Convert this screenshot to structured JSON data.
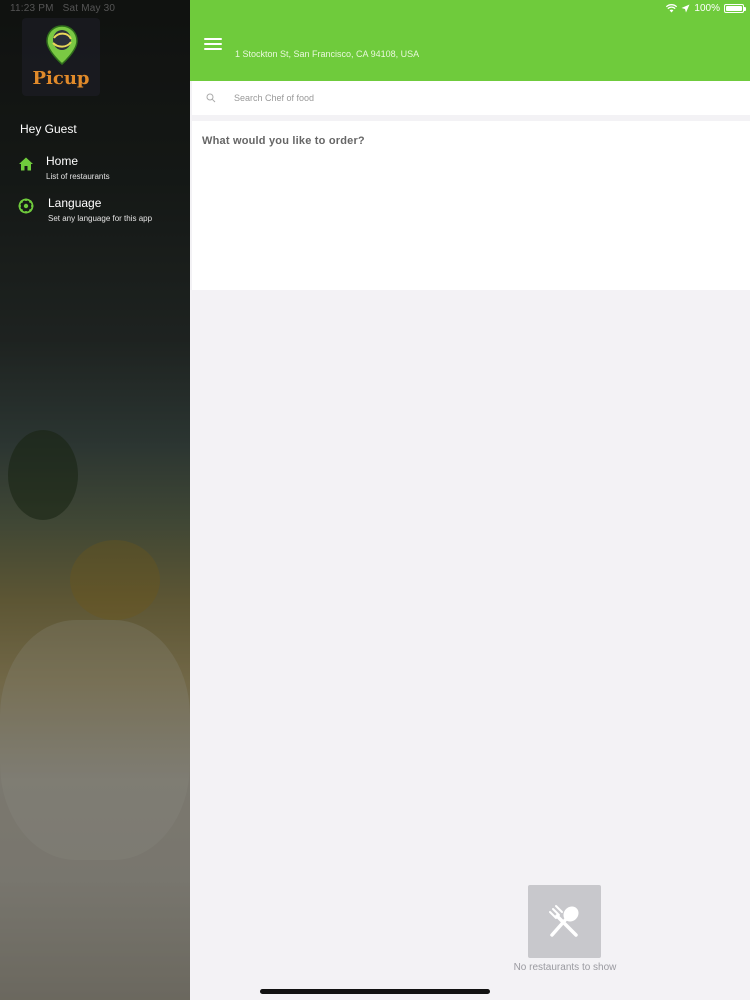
{
  "status_bar": {
    "time": "11:23 PM",
    "date": "Sat May 30",
    "battery": "100%",
    "battery_level": 1.0
  },
  "drawer": {
    "brand": "Picup",
    "greeting": "Hey Guest",
    "items": [
      {
        "label": "Home",
        "subtitle": "List of restaurants",
        "icon": "home-icon"
      },
      {
        "label": "Language",
        "subtitle": "Set any language for this app",
        "icon": "globe-icon"
      }
    ]
  },
  "header": {
    "address": "1 Stockton St, San Francisco, CA 94108, USA",
    "accent": "#6fcb3c"
  },
  "search": {
    "placeholder": "Search Chef of food",
    "value": ""
  },
  "main": {
    "order_prompt": "What would you like to order?",
    "empty_state": "No restaurants to show",
    "empty_icon": "fork-spoon-icon"
  }
}
